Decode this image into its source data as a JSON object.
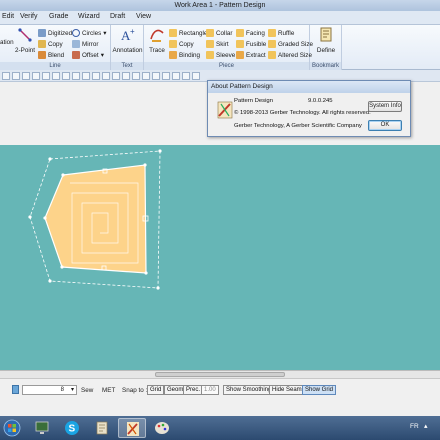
{
  "window": {
    "title": "Work Area 1 - Pattern Design"
  },
  "menu": [
    "Edit",
    "Verify",
    "Grade",
    "Wizard",
    "Draft",
    "View"
  ],
  "ribbon": {
    "line_group": {
      "label": "Line",
      "partial_left": "ation",
      "two_point": "2-Point",
      "digitized": "Digitized",
      "copy": "Copy",
      "blend": "Blend",
      "circles": "Circles",
      "mirror": "Mirror",
      "offset": "Offset"
    },
    "text_group": {
      "label": "Text",
      "annotation": "Annotation"
    },
    "piece_group": {
      "label": "Piece",
      "trace": "Trace",
      "rectangle": "Rectangle",
      "copy": "Copy",
      "binding": "Binding",
      "collar": "Collar",
      "skirt": "Skirt",
      "sleeve": "Sleeve",
      "facing": "Facing",
      "fusible": "Fusible",
      "extract": "Extract",
      "ruffle": "Ruffle",
      "graded_size": "Graded Size",
      "altered_size": "Altered Size"
    },
    "bookmark_group": {
      "label": "Bookmark",
      "define": "Define"
    }
  },
  "about_dialog": {
    "title": "About Pattern Design",
    "product": "Pattern Design",
    "version": "9.0.0.245",
    "copyright": "© 1998-2013 Gerber Technology.  All rights reserved.",
    "company": "Gerber Technology, A Gerber Scientific Company",
    "system_info_button": "System Info",
    "ok_button": "OK"
  },
  "statusbar": {
    "value": "8",
    "sew": "Sew",
    "unit": "MET",
    "snap_to": "Snap to :",
    "grid": "Grid",
    "geom": "Geom",
    "prec": "Prec.",
    "prec_value": "1.00",
    "show_smoothing": "Show Smoothing",
    "hide_seams": "Hide Seams",
    "show_grid": "Show Grid"
  },
  "tray": {
    "language": "FR"
  },
  "colors": {
    "canvas": "#66b6b6",
    "piece_fill": "#fdd38a",
    "piece_outline": "#ffffff",
    "seam_line": "#ffffff"
  }
}
